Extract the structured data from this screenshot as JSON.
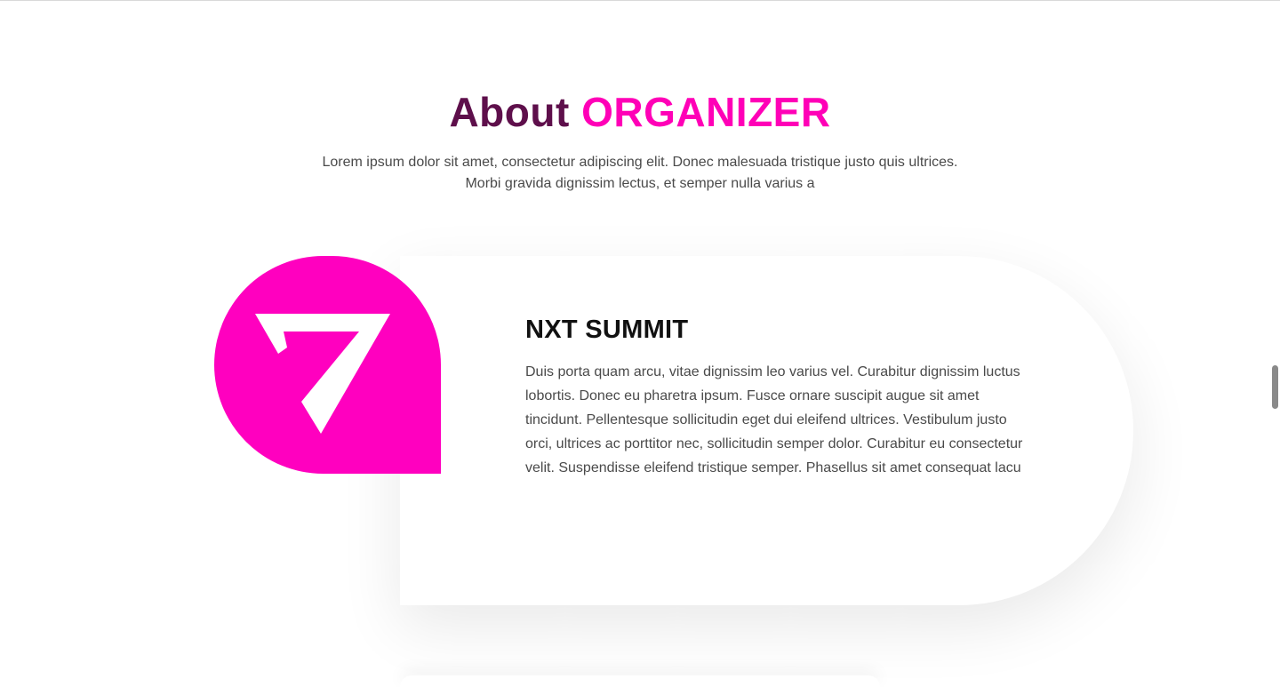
{
  "section": {
    "title_main": "About",
    "title_highlight": "ORGANIZER",
    "subtitle": "Lorem ipsum dolor sit amet, consectetur adipiscing elit. Donec malesuada tristique justo quis ultrices. Morbi gravida dignissim lectus, et semper nulla varius a"
  },
  "organizer": {
    "name": "NXT SUMMIT",
    "description": "Duis porta quam arcu, vitae dignissim leo varius vel. Curabitur dignissim luctus lobortis. Donec eu pharetra ipsum. Fusce ornare suscipit augue sit amet tincidunt. Pellentesque sollicitudin eget dui eleifend ultrices. Vestibulum justo orci, ultrices ac porttitor nec, sollicitudin semper dolor. Curabitur eu consectetur velit. Suspendisse eleifend tristique semper. Phasellus sit amet consequat lacu",
    "logo_icon": "nxt-summit-logo-icon"
  },
  "colors": {
    "title_dark": "#5e0f4b",
    "accent": "#ff00b7",
    "logo_background": "#ff00bf",
    "body_text": "#4a4a4a"
  }
}
